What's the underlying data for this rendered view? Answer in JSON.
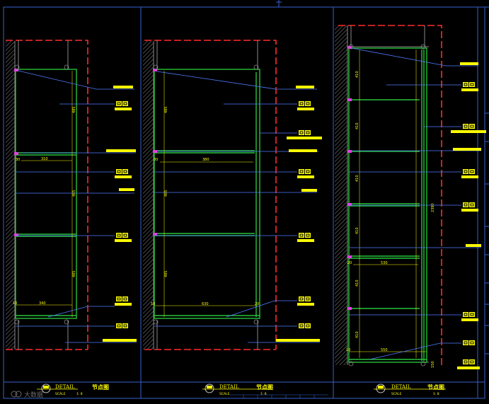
{
  "panels": [
    {
      "title_en": "DETAIL",
      "title_cn": "节点图",
      "scale_label": "SCALE",
      "scale_value": "1: 8",
      "dims": {
        "shelf_width_1": "310",
        "shelf_width_2": "340",
        "height_1": "485",
        "height_2": "485",
        "height_3": "485",
        "offset_1": "30",
        "offset_2": "10"
      }
    },
    {
      "title_en": "DETAIL",
      "title_cn": "节点图",
      "scale_label": "SCALE",
      "scale_value": "1: 8",
      "dims": {
        "shelf_width_1": "380",
        "shelf_width_2": "630",
        "height_1": "485",
        "height_2": "485",
        "height_3": "485",
        "offset_1": "30",
        "offset_2": "10",
        "offset_3": "20"
      }
    },
    {
      "title_en": "DETAIL",
      "title_cn": "节点图",
      "scale_label": "SCALE",
      "scale_value": "1: 8",
      "dims": {
        "shelf_width_1": "530",
        "shelf_width_2": "550",
        "total_height": "2390",
        "row_heights": [
          "410",
          "410",
          "410",
          "410",
          "410",
          "410"
        ],
        "offset_1": "20",
        "offset_2": "10",
        "offset_3": "150"
      }
    }
  ],
  "watermark": "大数据",
  "colors": {
    "background": "#000000",
    "frame": "#3a5fd0",
    "leader": "#4f7bff",
    "cabinet": "#27c23a",
    "wall": "#888888",
    "ceiling_dash": "#ff2a2a",
    "annotation": "#ffff00",
    "joint": "#e040e0"
  }
}
